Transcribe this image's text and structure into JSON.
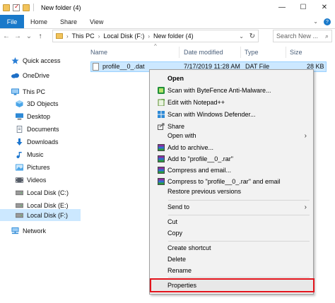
{
  "window": {
    "title": "New folder (4)",
    "controls": [
      "—",
      "☐",
      "✕"
    ]
  },
  "ribbon": {
    "tabs": [
      "File",
      "Home",
      "Share",
      "View"
    ],
    "expand_icon": "chevron-down-icon",
    "help_icon": "?"
  },
  "address": {
    "back": "←",
    "forward": "→",
    "recent": "⌄",
    "up": "↑",
    "path": [
      "This PC",
      "Local Disk (F:)",
      "New folder (4)"
    ],
    "separator": "›",
    "search_placeholder": "Search New ..."
  },
  "nav": {
    "items": [
      {
        "label": "Quick access",
        "icon": "star-icon",
        "color": "#2b7fd6"
      },
      {
        "label": "OneDrive",
        "icon": "cloud-icon",
        "color": "#1e6fc6"
      },
      {
        "label": "This PC",
        "icon": "computer-icon",
        "color": "#2d89d6"
      },
      {
        "label": "3D Objects",
        "icon": "cube-icon",
        "color": "#4aa5e8"
      },
      {
        "label": "Desktop",
        "icon": "desktop-icon",
        "color": "#2d89d6"
      },
      {
        "label": "Documents",
        "icon": "documents-icon",
        "color": "#6d7b8c"
      },
      {
        "label": "Downloads",
        "icon": "download-icon",
        "color": "#1e77cf"
      },
      {
        "label": "Music",
        "icon": "music-icon",
        "color": "#1e77cf"
      },
      {
        "label": "Pictures",
        "icon": "pictures-icon",
        "color": "#4aa5e8"
      },
      {
        "label": "Videos",
        "icon": "videos-icon",
        "color": "#555b66"
      },
      {
        "label": "Local Disk (C:)",
        "icon": "drive-icon",
        "color": "#6b6b6b"
      },
      {
        "label": "Local Disk (E:)",
        "icon": "drive-icon",
        "color": "#6b6b6b"
      },
      {
        "label": "Local Disk (F:)",
        "icon": "drive-icon",
        "color": "#6b6b6b",
        "selected": true
      },
      {
        "label": "Network",
        "icon": "network-icon",
        "color": "#2d89d6"
      }
    ]
  },
  "list": {
    "columns": [
      "Name",
      "Date modified",
      "Type",
      "Size"
    ],
    "sort_indicator": "^",
    "files": [
      {
        "name": "profile__0_.dat",
        "date": "7/17/2019 11:28 AM",
        "type": "DAT File",
        "size": "28 KB"
      }
    ]
  },
  "menu": {
    "items": [
      {
        "label": "Open",
        "bold": true
      },
      {
        "label": "Scan with ByteFence Anti-Malware...",
        "icon": "bytefence-icon"
      },
      {
        "label": "Edit with Notepad++",
        "icon": "notepadpp-icon"
      },
      {
        "label": "Scan with Windows Defender...",
        "icon": "defender-icon"
      },
      {
        "label": "Share",
        "icon": "share-icon"
      },
      {
        "label": "Open with",
        "arrow": "›"
      },
      {
        "label": "Add to archive...",
        "icon": "winrar-icon"
      },
      {
        "label": "Add to \"profile__0_.rar\"",
        "icon": "winrar-icon"
      },
      {
        "label": "Compress and email...",
        "icon": "winrar-icon"
      },
      {
        "label": "Compress to \"profile__0_.rar\" and email",
        "icon": "winrar-icon"
      },
      {
        "label": "Restore previous versions"
      },
      {
        "label": "Send to",
        "arrow": "›"
      },
      {
        "label": "Cut"
      },
      {
        "label": "Copy"
      },
      {
        "label": "Create shortcut"
      },
      {
        "label": "Delete"
      },
      {
        "label": "Rename"
      },
      {
        "label": "Properties",
        "highlighted": true
      }
    ],
    "highlight_color": "#e3141c"
  }
}
